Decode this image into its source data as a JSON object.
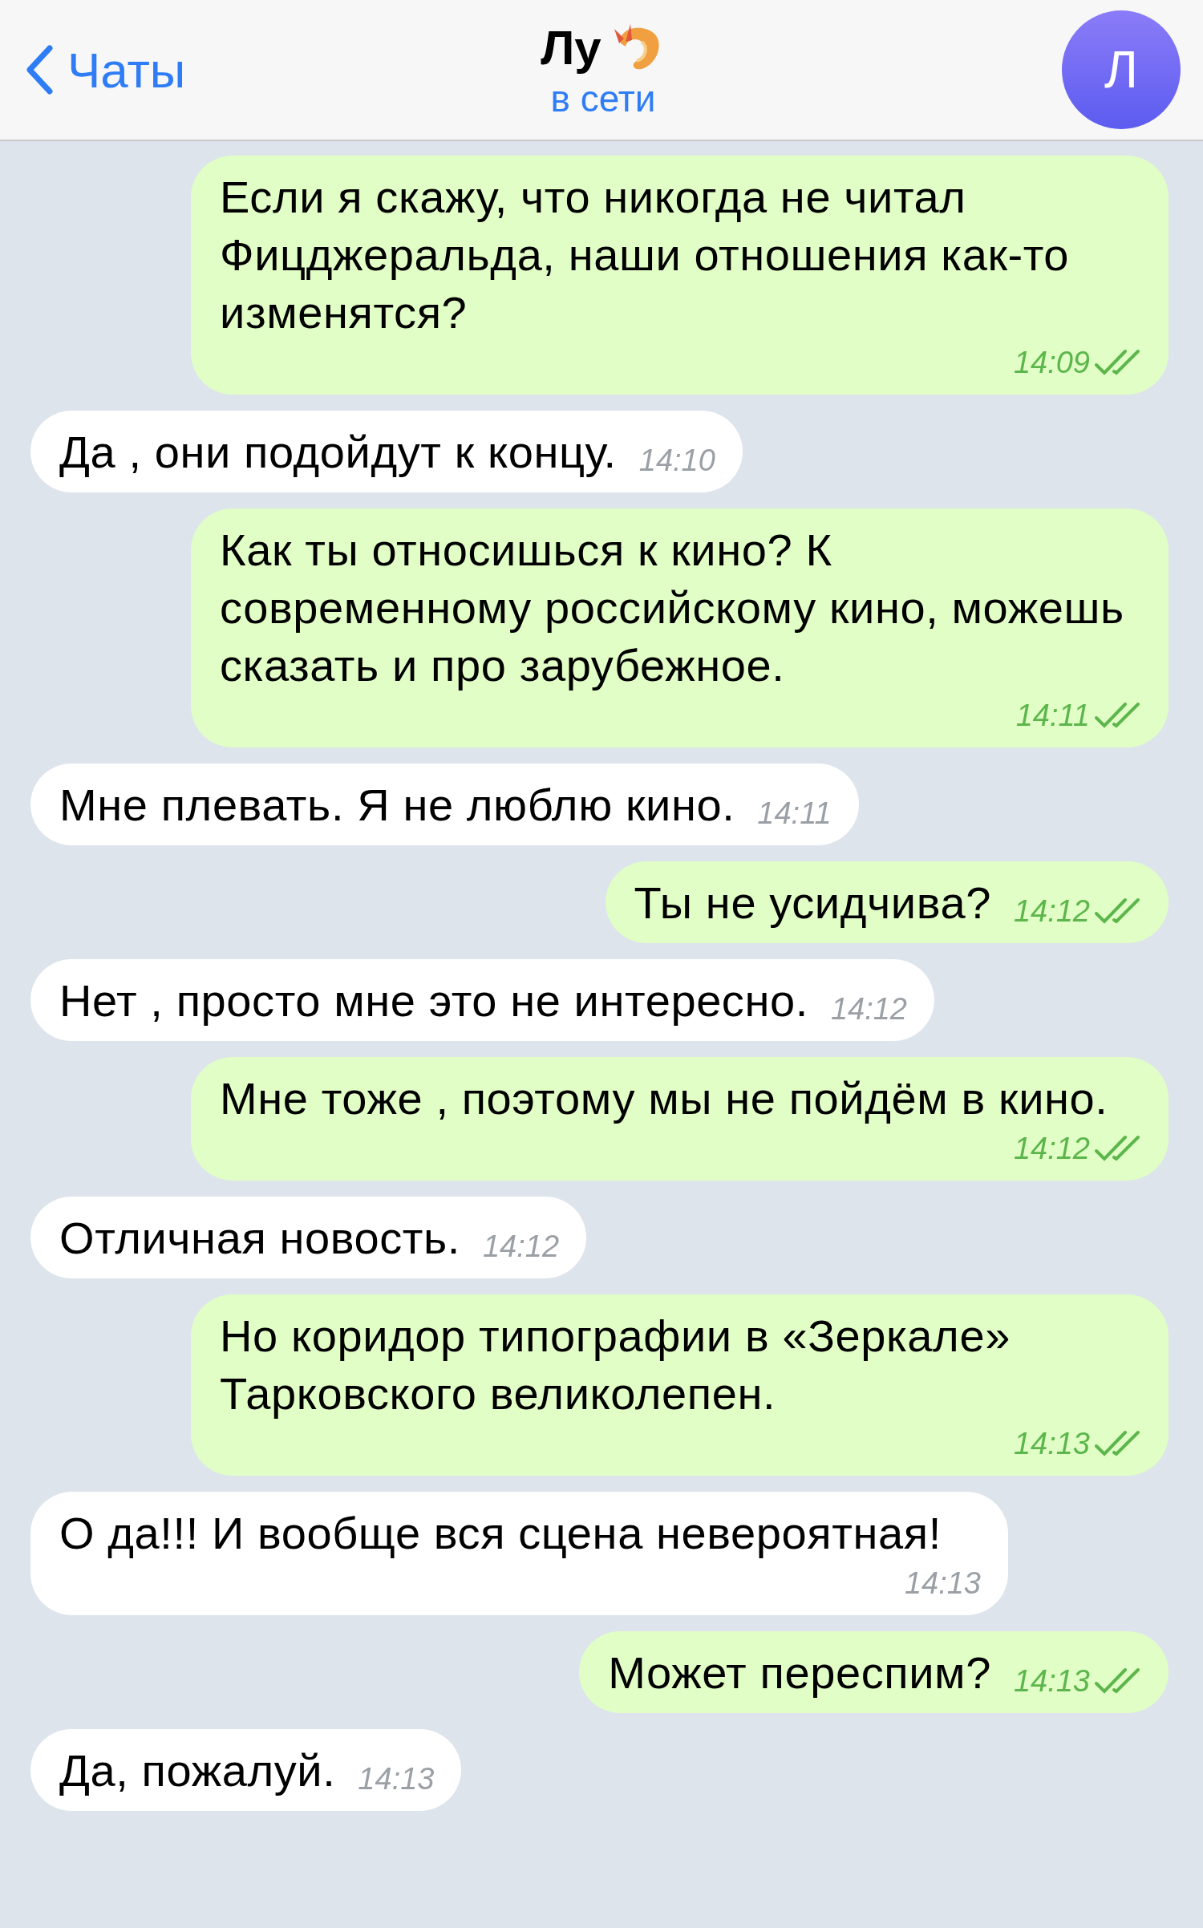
{
  "header": {
    "back_label": "Чаты",
    "title": "Лу",
    "status": "в сети",
    "avatar_letter": "Л"
  },
  "messages": [
    {
      "kind": "out",
      "text": "Если я скажу, что никогда не читал Фицджеральда, наши отношения как-то изменятся?",
      "time": "14:09",
      "read": true
    },
    {
      "kind": "in",
      "text": "Да , они подойдут к концу.",
      "time": "14:10"
    },
    {
      "kind": "out",
      "text": "Как ты относишься к кино? К современному российскому кино, можешь сказать и про зарубежное.",
      "time": "14:11",
      "read": true
    },
    {
      "kind": "in",
      "text": "Мне плевать. Я не люблю кино.",
      "time": "14:11"
    },
    {
      "kind": "out",
      "text": "Ты не усидчива?",
      "time": "14:12",
      "read": true
    },
    {
      "kind": "in",
      "text": "Нет , просто мне это не интересно.",
      "time": "14:12"
    },
    {
      "kind": "out",
      "text": "Мне тоже , поэтому мы не пойдём в кино.",
      "time": "14:12",
      "read": true
    },
    {
      "kind": "in",
      "text": "Отличная новость.",
      "time": "14:12"
    },
    {
      "kind": "out",
      "text": "Но коридор типографии в «Зеркале» Тарковского великолепен.",
      "time": "14:13",
      "read": true
    },
    {
      "kind": "in",
      "text": "О да!!! И вообще вся сцена невероятная!",
      "time": "14:13"
    },
    {
      "kind": "out",
      "text": "Может переспим?",
      "time": "14:13",
      "read": true
    },
    {
      "kind": "in",
      "text": "Да, пожалуй.",
      "time": "14:13"
    }
  ]
}
